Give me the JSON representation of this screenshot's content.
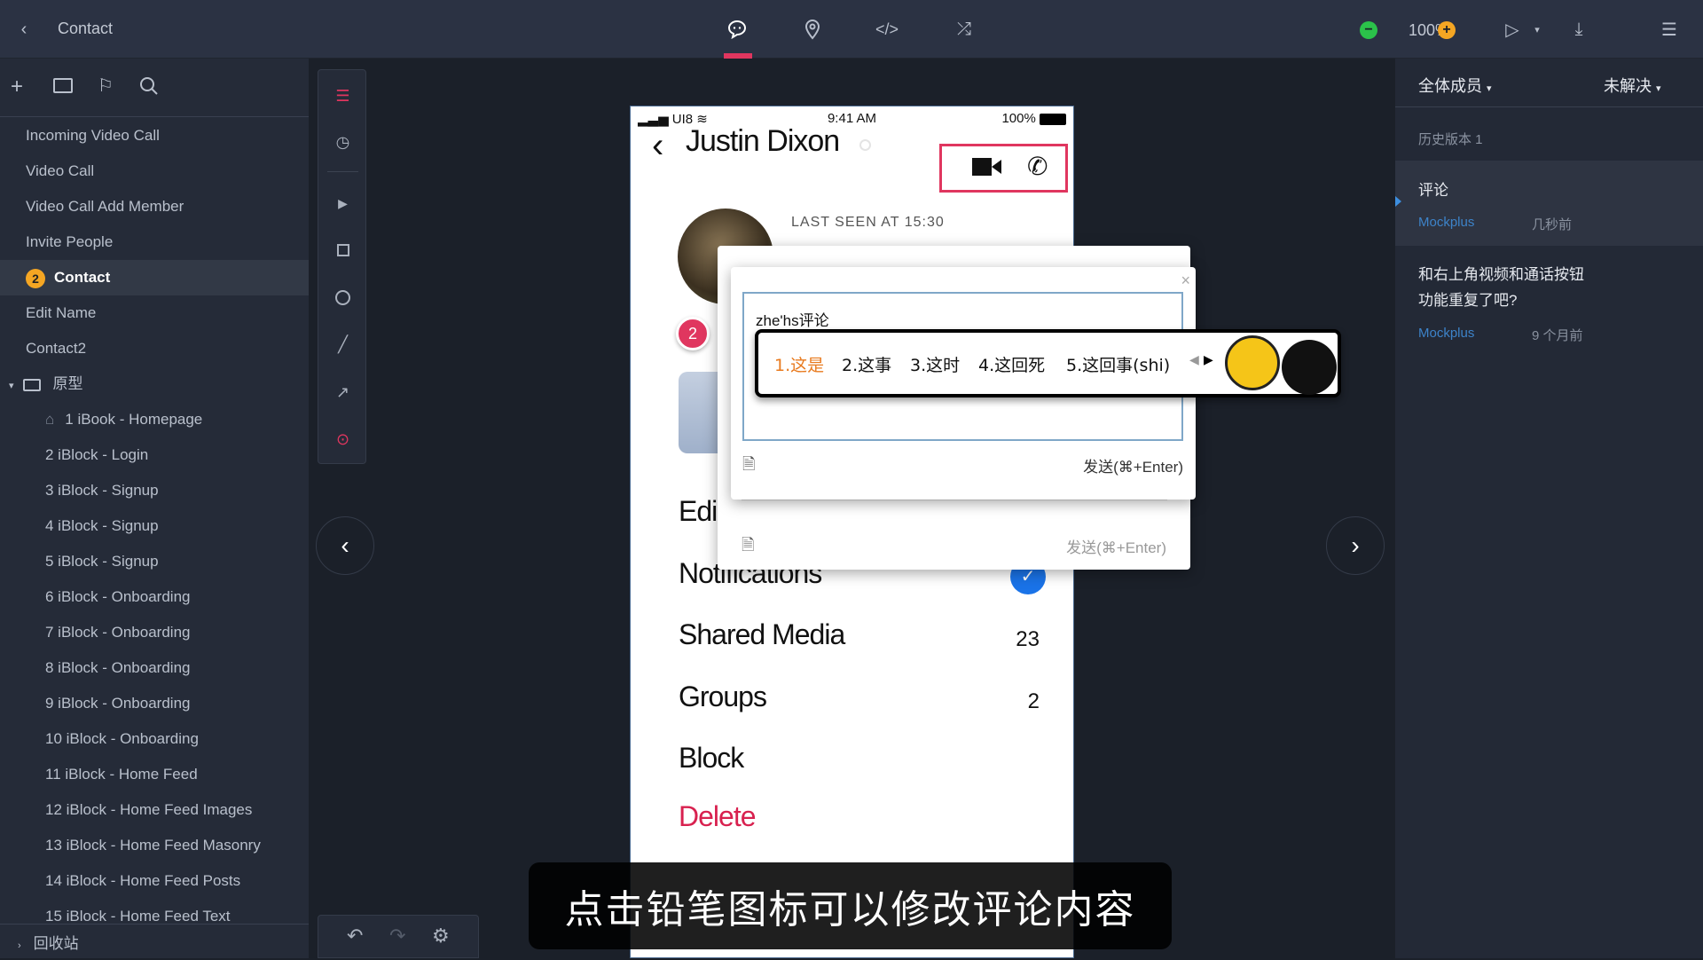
{
  "topbar": {
    "back_icon": "chevron-left",
    "title": "Contact",
    "center_icons": [
      "comment-icon",
      "location-pin-icon",
      "code-icon",
      "shuffle-icon"
    ],
    "zoom": "100%",
    "colors": {
      "zoom_out": "#2bc24a",
      "zoom_in": "#f5a623",
      "active_tab": "#e0365f"
    }
  },
  "sidebar": {
    "toolbar": [
      "plus-icon",
      "folder-icon",
      "flag-icon",
      "search-icon"
    ],
    "items": [
      {
        "label": "Incoming Video Call"
      },
      {
        "label": "Video Call"
      },
      {
        "label": "Video Call Add Member"
      },
      {
        "label": "Invite People"
      },
      {
        "label": "Contact",
        "badge": "2",
        "active": true
      },
      {
        "label": "Edit Name"
      },
      {
        "label": "Contact2"
      }
    ],
    "folder": {
      "label": "原型",
      "children": [
        "1 iBook - Homepage",
        "2 iBlock - Login",
        "3 iBlock - Signup",
        "4 iBlock - Signup",
        "5 iBlock - Signup",
        "6 iBlock - Onboarding",
        "7 iBlock - Onboarding",
        "8 iBlock - Onboarding",
        "9 iBlock - Onboarding",
        "10 iBlock - Onboarding",
        "11 iBlock - Home Feed",
        "12 iBlock - Home Feed Images",
        "13 iBlock - Home Feed Masonry",
        "14 iBlock - Home Feed Posts",
        "15 iBlock - Home Feed Text"
      ]
    },
    "trash": "回收站"
  },
  "phone": {
    "status": {
      "carrier": "UI8",
      "time": "9:41 AM",
      "battery": "100%"
    },
    "name": "Justin Dixon",
    "last_seen": "LAST SEEN AT 15:30",
    "comment_badge": "2",
    "rows": {
      "edit": "Edi",
      "notifications": "Notifications",
      "shared_media": "Shared Media",
      "shared_media_count": "23",
      "groups": "Groups",
      "groups_count": "2",
      "block": "Block",
      "delete": "Delete"
    }
  },
  "comment_popup": {
    "input_value": "zhe'hs评论",
    "send": "发送(⌘+Enter)",
    "send_back": "发送(⌘+Enter)"
  },
  "ime": {
    "candidates": [
      "1.这是",
      "2.这事",
      "3.这时",
      "4.这回死",
      "5.这回事(shi)"
    ]
  },
  "right_panel": {
    "filter_members": "全体成员",
    "filter_status": "未解决",
    "version": "历史版本 1",
    "comments": [
      {
        "text": "评论",
        "author": "Mockplus",
        "time": "几秒前"
      },
      {
        "text": "和右上角视频和通话按钮功能重复了吧?",
        "author": "Mockplus",
        "time": "9 个月前"
      }
    ]
  },
  "subtitle": "点击铅笔图标可以修改评论内容"
}
